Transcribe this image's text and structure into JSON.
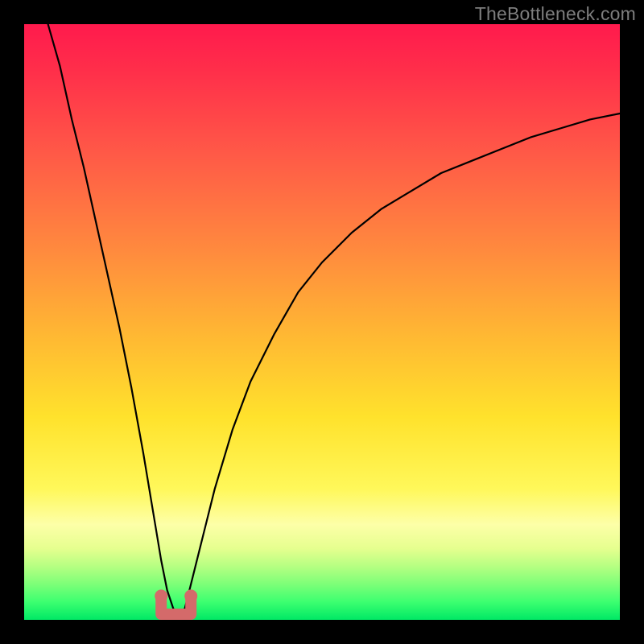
{
  "watermark": "TheBottleneck.com",
  "colors": {
    "curve": "#000000",
    "optimal_marker": "#d46a6a",
    "frame": "#000000"
  },
  "chart_data": {
    "type": "line",
    "title": "",
    "xlabel": "",
    "ylabel": "",
    "xlim": [
      0,
      100
    ],
    "ylim": [
      0,
      100
    ],
    "grid": false,
    "series": [
      {
        "name": "bottleneck-curve",
        "x": [
          4,
          6,
          8,
          10,
          12,
          14,
          16,
          18,
          20,
          21,
          22,
          23,
          24,
          25,
          26,
          27,
          28,
          30,
          32,
          35,
          38,
          42,
          46,
          50,
          55,
          60,
          65,
          70,
          75,
          80,
          85,
          90,
          95,
          100
        ],
        "y": [
          100,
          93,
          84,
          76,
          67,
          58,
          49,
          39,
          28,
          22,
          16,
          10,
          5,
          2,
          0,
          2,
          6,
          14,
          22,
          32,
          40,
          48,
          55,
          60,
          65,
          69,
          72,
          75,
          77,
          79,
          81,
          82.5,
          84,
          85
        ]
      }
    ],
    "optimal_marker": {
      "x_range": [
        23,
        28
      ],
      "y": 0
    }
  }
}
